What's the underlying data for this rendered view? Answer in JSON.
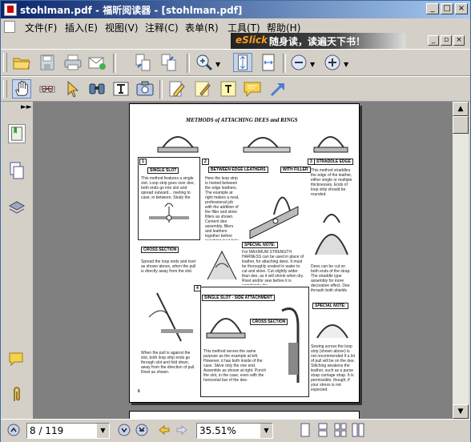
{
  "window": {
    "title": "stohlman.pdf - 福昕阅读器 - [stohlman.pdf]",
    "controls": [
      "_",
      "□",
      "×"
    ]
  },
  "menu": {
    "items": [
      "文件(F)",
      "插入(E)",
      "视图(V)",
      "注释(C)",
      "表单(R)",
      "工具(T)",
      "帮助(H)"
    ]
  },
  "banner": {
    "brand": "eSlick",
    "text": "随身读，读遍天下书！"
  },
  "toolbar1": {
    "buttons": [
      "open-icon",
      "save-icon",
      "print-icon",
      "email-icon",
      "page-layout-icon",
      "page-layout2-icon",
      "zoom-icon",
      "fit-page-icon",
      "fit-width-icon",
      "zoom-out-icon",
      "zoom-in-icon"
    ]
  },
  "toolbar2": {
    "buttons": [
      "hand-tool-icon",
      "text-select-icon",
      "select-arrow-icon",
      "find-icon",
      "typewriter-icon",
      "snapshot-icon",
      "highlight-icon",
      "note-icon",
      "textbox-icon",
      "comment-icon",
      "arrow-tool-icon"
    ]
  },
  "page": {
    "heading": "METHODS of ATTACHING DEES and RINGS",
    "sections": [
      {
        "num": "1",
        "label": "SINGLE SLOT"
      },
      {
        "num": "2",
        "label": "BETWEEN EDGE LEATHERS"
      },
      {
        "num": "3",
        "label": "STRADDLE EDGE"
      },
      {
        "num": "4",
        "label": "SINGLE SLOT - SIDE ATTACHMENT"
      }
    ],
    "extra_labels": [
      "CROSS SECTION",
      "WITH FILLER",
      "SPECIAL NOTE:",
      "SPECIAL NOTE:"
    ],
    "texts": {
      "s1": "This method features a single slot. Loop strip goes over dee, both ends go into slot and spread outward... riveting to case, in between. Study the cross section views below.",
      "s2": "Here the loop strip is riveted between the edge leathers. The example at right makes a neat, professional job with the addition of the filler and skive fillers as shown. Cement dee assembly, fillers and leathers together before punching rivet hole, and sewing.",
      "s3": "This method straddles the edge of the leather, either single or multiple thicknesses. Ends of loop strip should be rounded.",
      "note": "For MAXIMUM STRENGTH HARNESS can be used in place of leather, for attaching dees. It must be thoroughly soaked in water to cut and skive. Cut slightly wider than dee, as it will shrink when dry. Rivet and/or sew before it is completely dry.",
      "s1b": "Spread the loop ends and rivet as shown above, when the pull is directly away from the slot.",
      "s4": "This method serves the same purpose as the example at left. However, it has both inside of the case. Skive only the one end. Assemble as shown at right. Punch the slot, in the case, even with the horizontal bar of the dee.",
      "s1c": "When the pull is against the slot, both loop strip ends go through slot and fold down, away from the direction of pull. Rivet as shown.",
      "s3b": "Dees can be cut on both ends of the strap. The straddle type assembly for more decorative effect. Dee through both shields and sew.",
      "note2": "Sewing across the loop strip (shown above) is not recommended if a lot of pull will be on the dee. Stitching weakens the leather, such as a purse strap carriage strap. It is permissible, though, if your stress is not expected.",
      "page_num": "6"
    }
  },
  "status": {
    "page_value": "8 / 119",
    "zoom_value": "35.51%"
  },
  "colors": {
    "titlebar_start": "#0a246a",
    "titlebar_end": "#a6caf0",
    "viewer_bg": "#808080",
    "banner_brand": "#ff9a20"
  }
}
